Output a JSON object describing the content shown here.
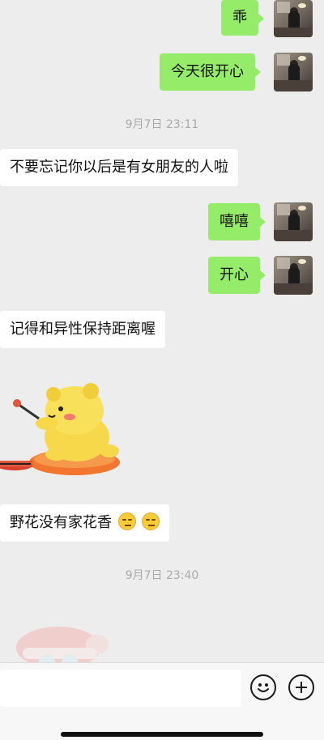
{
  "messages": {
    "m1": "乖",
    "m2": "今天很开心",
    "t1": "9月7日 23:11",
    "m3": "不要忘记你以后是有女朋友的人啦",
    "m4": "嘻嘻",
    "m5": "开心",
    "m6": "记得和异性保持距离喔",
    "m7": "野花没有家花香",
    "t2": "9月7日 23:40"
  },
  "stickers": {
    "bear": "yellow-bear-drumming-sticker",
    "santa": "santa-hat-sticker"
  },
  "emoji": {
    "face": "unamused-face-emoji"
  },
  "input": {
    "placeholder": ""
  },
  "icons": {
    "emoji_button": "smiley-icon",
    "add_button": "plus-icon"
  },
  "colors": {
    "background": "#ededed",
    "sent_bubble": "#95ec69",
    "received_bubble": "#ffffff"
  }
}
